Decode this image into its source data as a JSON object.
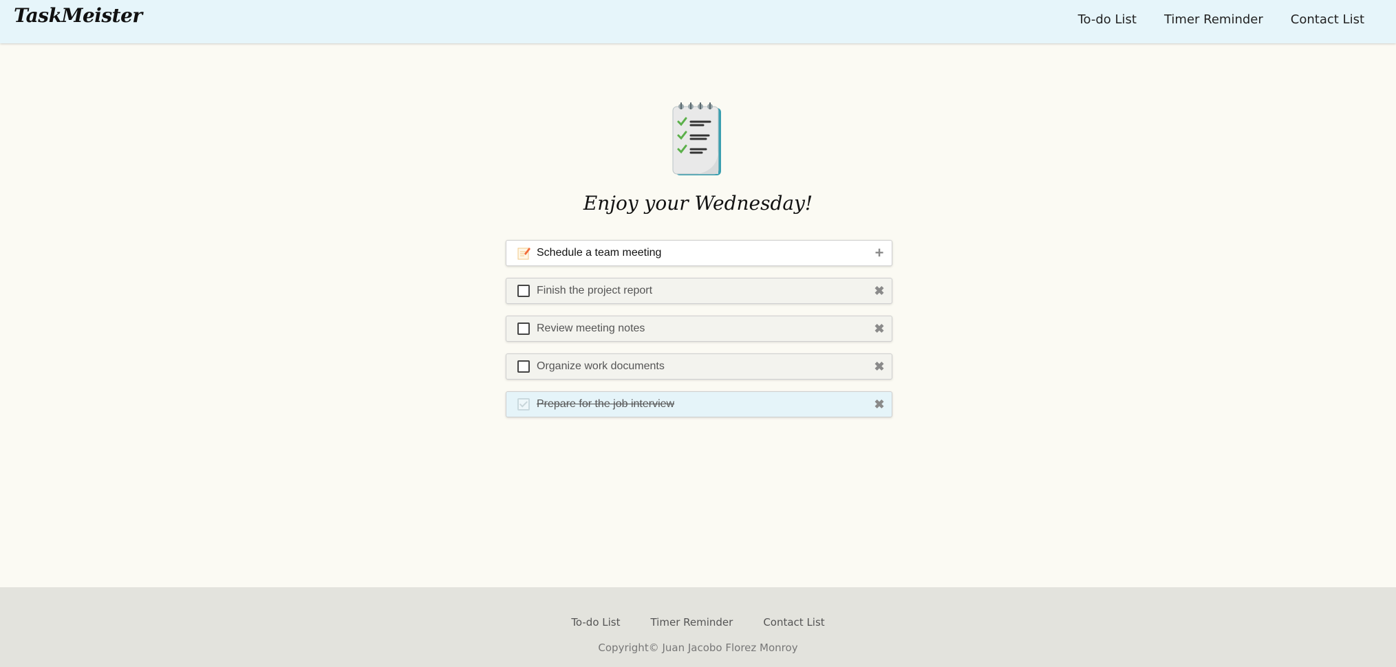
{
  "header": {
    "brand": "TaskMeister",
    "nav": [
      "To-do List",
      "Timer Reminder",
      "Contact List"
    ]
  },
  "main": {
    "logo_icon": "notepad-checklist-icon",
    "greeting": "Enjoy your Wednesday!",
    "new_task": {
      "value": "Schedule a team meeting",
      "icon": "memo-icon",
      "add_icon": "plus-icon"
    },
    "tasks": [
      {
        "label": "Finish the project report",
        "done": false
      },
      {
        "label": "Review meeting notes",
        "done": false
      },
      {
        "label": "Organize work documents",
        "done": false
      },
      {
        "label": "Prepare for the job interview",
        "done": true
      }
    ]
  },
  "footer": {
    "nav": [
      "To-do List",
      "Timer Reminder",
      "Contact List"
    ],
    "copyright": "Copyright© Juan Jacobo Florez Monroy"
  },
  "colors": {
    "header_bg": "#e6f5fa",
    "page_bg": "#fbfaf3",
    "task_bg": "#f3f3ee",
    "done_task_bg": "#e5f4f9",
    "footer_bg": "#e3e3dd"
  }
}
